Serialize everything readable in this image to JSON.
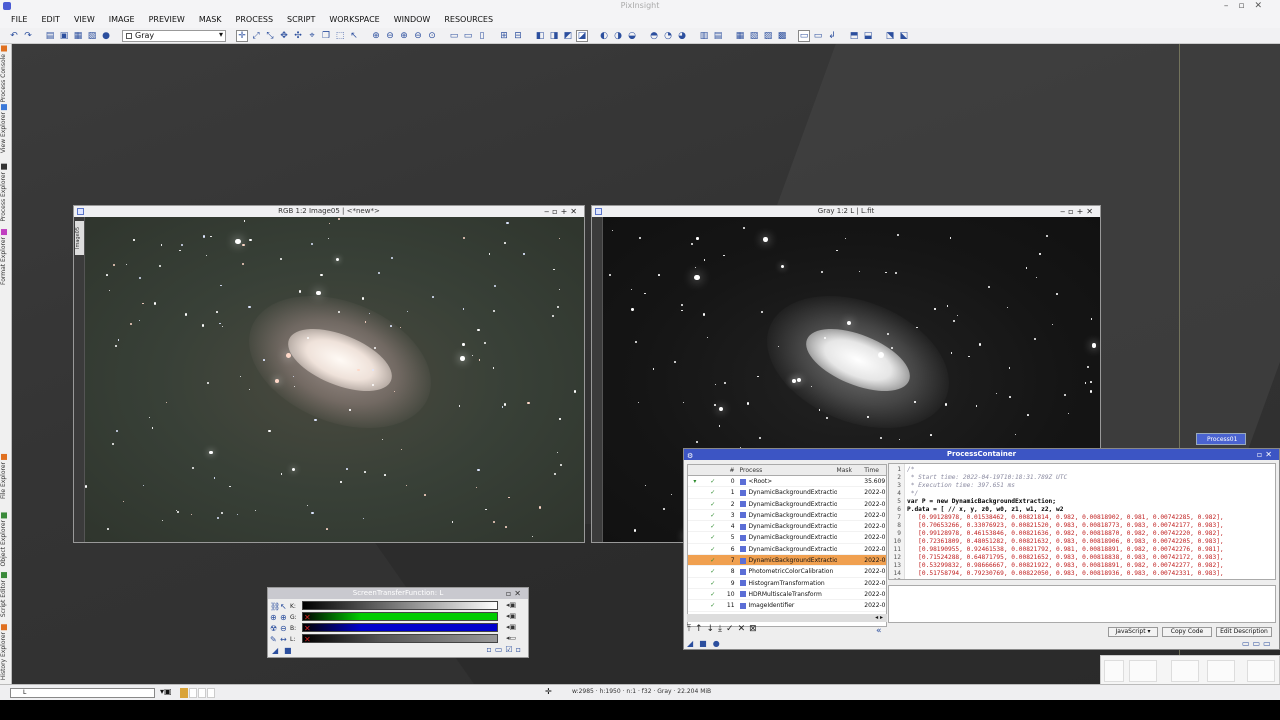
{
  "app": {
    "title": "PixInsight"
  },
  "menu": [
    "FILE",
    "EDIT",
    "VIEW",
    "IMAGE",
    "PREVIEW",
    "MASK",
    "PROCESS",
    "SCRIPT",
    "WORKSPACE",
    "WINDOW",
    "RESOURCES"
  ],
  "toolbar": {
    "view_combo": "Gray"
  },
  "side_tabs": [
    "Process Console",
    "View Explorer",
    "Process Explorer",
    "Format Explorer",
    "File Explorer",
    "Object Explorer",
    "Script Editor",
    "History Explorer"
  ],
  "windows": {
    "rgb": {
      "title": "RGB 1:2 Image05 | <*new*>",
      "id": "Image05"
    },
    "gray": {
      "title": "Gray 1:2 L | L.fit"
    }
  },
  "stf": {
    "title": "ScreenTransferFunction: L",
    "channels": [
      "K:",
      "G:",
      "B:",
      "L:"
    ]
  },
  "process_icon": {
    "label": "Process01"
  },
  "process_container": {
    "title": "ProcessContainer",
    "columns": [
      "#",
      "Process",
      "Mask",
      "Time"
    ],
    "rows": [
      {
        "num": "0",
        "process": "<Root>",
        "time": "35.609",
        "sel": false
      },
      {
        "num": "1",
        "process": "DynamicBackgroundExtraction",
        "time": "2022-0",
        "sel": false
      },
      {
        "num": "2",
        "process": "DynamicBackgroundExtraction",
        "time": "2022-0",
        "sel": false
      },
      {
        "num": "3",
        "process": "DynamicBackgroundExtraction",
        "time": "2022-0",
        "sel": false
      },
      {
        "num": "4",
        "process": "DynamicBackgroundExtraction",
        "time": "2022-0",
        "sel": false
      },
      {
        "num": "5",
        "process": "DynamicBackgroundExtraction",
        "time": "2022-0",
        "sel": false
      },
      {
        "num": "6",
        "process": "DynamicBackgroundExtraction",
        "time": "2022-0",
        "sel": false
      },
      {
        "num": "7",
        "process": "DynamicBackgroundExtraction",
        "time": "2022-0",
        "sel": true
      },
      {
        "num": "8",
        "process": "PhotometricColorCalibration",
        "time": "2022-0",
        "sel": false
      },
      {
        "num": "9",
        "process": "HistogramTransformation",
        "time": "2022-0",
        "sel": false
      },
      {
        "num": "10",
        "process": "HDRMultiscaleTransform",
        "time": "2022-0",
        "sel": false
      },
      {
        "num": "11",
        "process": "ImageIdentifier",
        "time": "2022-0",
        "sel": false
      }
    ],
    "code": [
      {
        "n": "1",
        "t": "/*",
        "c": "cm"
      },
      {
        "n": "2",
        "t": " * Start time: 2022-04-19T10:18:31.789Z UTC",
        "c": "cm"
      },
      {
        "n": "3",
        "t": " * Execution time: 397.651 ms",
        "c": "cm"
      },
      {
        "n": "4",
        "t": " */",
        "c": "cm"
      },
      {
        "n": "5",
        "t": "var P = new DynamicBackgroundExtraction;",
        "c": "kw"
      },
      {
        "n": "6",
        "t": "P.data = [ // x, y, z0, w0, z1, w1, z2, w2",
        "c": "kw"
      },
      {
        "n": "7",
        "t": "   [0.99128978, 0.01538462, 0.00821814, 0.982, 0.00818902, 0.981, 0.00742285, 0.982],",
        "c": "num"
      },
      {
        "n": "8",
        "t": "   [0.70653266, 0.33076923, 0.00821520, 0.983, 0.00818773, 0.983, 0.00742177, 0.983],",
        "c": "num"
      },
      {
        "n": "9",
        "t": "   [0.99128978, 0.46153846, 0.00821636, 0.982, 0.00818870, 0.982, 0.00742220, 0.982],",
        "c": "num"
      },
      {
        "n": "10",
        "t": "   [0.72361809, 0.48051282, 0.00821632, 0.983, 0.00818906, 0.983, 0.00742205, 0.983],",
        "c": "num"
      },
      {
        "n": "11",
        "t": "   [0.98190955, 0.92461538, 0.00821792, 0.981, 0.00818891, 0.982, 0.00742276, 0.981],",
        "c": "num"
      },
      {
        "n": "12",
        "t": "   [0.71524288, 0.64871795, 0.00821652, 0.983, 0.00818838, 0.983, 0.00742172, 0.983],",
        "c": "num"
      },
      {
        "n": "13",
        "t": "   [0.53299832, 0.98666667, 0.00821922, 0.983, 0.00818891, 0.982, 0.00742277, 0.982],",
        "c": "num"
      },
      {
        "n": "14",
        "t": "   [0.51758794, 0.79230769, 0.00822050, 0.983, 0.00818936, 0.983, 0.00742331, 0.983],",
        "c": "num"
      },
      {
        "n": "15",
        "t": "",
        "c": "num"
      }
    ],
    "lang": "JavaScript",
    "copy_code": "Copy Code",
    "edit_description": "Edit Description"
  },
  "statusbar": {
    "view_field": "L",
    "info": "w:2985 · h:1950 · n:1 · f32 · Gray · 22.204 MiB"
  }
}
